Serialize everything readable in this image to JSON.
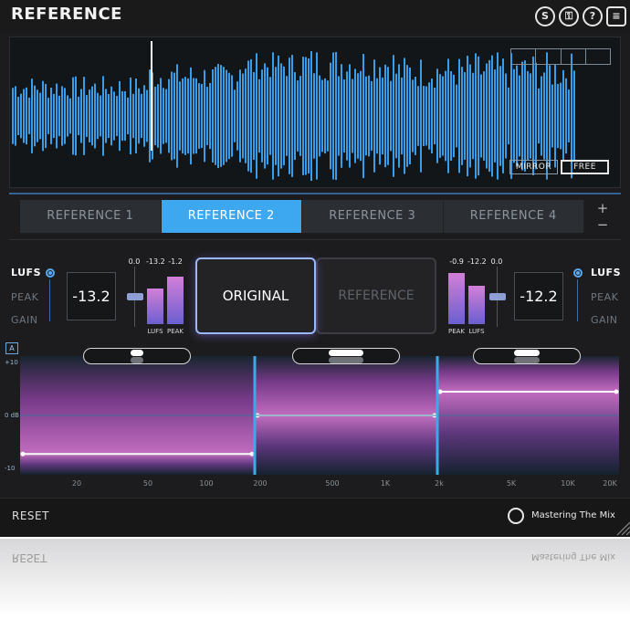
{
  "header": {
    "title": "REFERENCE",
    "buttons": [
      {
        "name": "s-button",
        "glyph": "S"
      },
      {
        "name": "key-button",
        "glyph": "⚿"
      },
      {
        "name": "help-button",
        "glyph": "?"
      },
      {
        "name": "menu-button",
        "glyph": "≡"
      }
    ]
  },
  "waveform": {
    "mirror_label": "MIRROR",
    "free_label": "FREE",
    "color": "#3a9de8"
  },
  "tabs": {
    "items": [
      "REFERENCE 1",
      "REFERENCE 2",
      "REFERENCE 3",
      "REFERENCE 4"
    ],
    "active_index": 1,
    "add": "+",
    "remove": "−"
  },
  "left_meter": {
    "modes": [
      "LUFS",
      "PEAK",
      "GAIN"
    ],
    "active_mode": "LUFS",
    "readout": "-13.2",
    "top_value": "0.0",
    "lufs_value": "-13.2",
    "peak_value": "-1.2",
    "lufs_label": "LUFS",
    "peak_label": "PEAK"
  },
  "right_meter": {
    "modes": [
      "LUFS",
      "PEAK",
      "GAIN"
    ],
    "active_mode": "LUFS",
    "readout": "-12.2",
    "top_value": "0.0",
    "lufs_value": "-12.2",
    "peak_value": "-0.9",
    "lufs_label": "LUFS",
    "peak_label": "PEAK"
  },
  "toggle": {
    "original": "ORIGINAL",
    "reference": "REFERENCE",
    "selected": "ORIGINAL"
  },
  "eq": {
    "a_label": "A",
    "db_labels": {
      "top": "+10",
      "zero": "0 dB",
      "bottom": "-10"
    },
    "freq_labels": [
      "20",
      "50",
      "100",
      "200",
      "500",
      "1K",
      "2k",
      "5K",
      "10K",
      "20K"
    ],
    "band_levels_db": [
      -6.5,
      0,
      4
    ]
  },
  "footer": {
    "reset": "RESET",
    "brand": "Mastering The Mix"
  },
  "colors": {
    "accent": "#3da8f0",
    "magenta": "#e07ad8",
    "background": "#1c1c1e"
  }
}
